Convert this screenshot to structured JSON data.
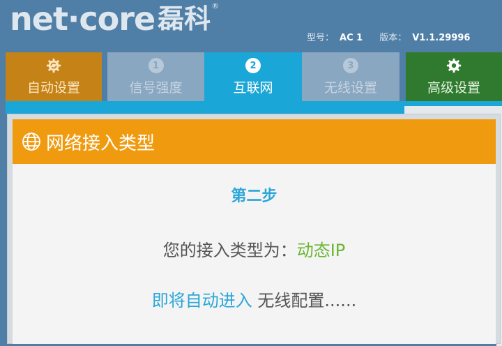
{
  "brand": {
    "logo_text": "net·core",
    "logo_cn": "磊科",
    "reg_mark": "®"
  },
  "device": {
    "model_label": "型号：",
    "model_value": "AC 1",
    "version_label": "版本：",
    "version_value": "V1.1.29996"
  },
  "nav": {
    "auto": {
      "label": "自动设置",
      "icon": "gear-sync-icon"
    },
    "step1": {
      "label": "信号强度",
      "number": "1"
    },
    "step2": {
      "label": "互联网",
      "number": "2"
    },
    "step3": {
      "label": "无线设置",
      "number": "3"
    },
    "advanced": {
      "label": "高级设置",
      "icon": "gear-icon"
    }
  },
  "modal": {
    "title": "网络接入类型",
    "step_text": "第二步",
    "access_prefix": "您的接入类型为：",
    "access_type": "动态IP",
    "redirect_blue": "即将自动进入",
    "redirect_rest": " 无线配置......"
  },
  "colors": {
    "accent_orange": "#f09b0f",
    "active_tab": "#1aa6d6",
    "advanced_tab": "#2f7a2e",
    "auto_tab": "#c58317",
    "ip_green": "#6ab531"
  }
}
